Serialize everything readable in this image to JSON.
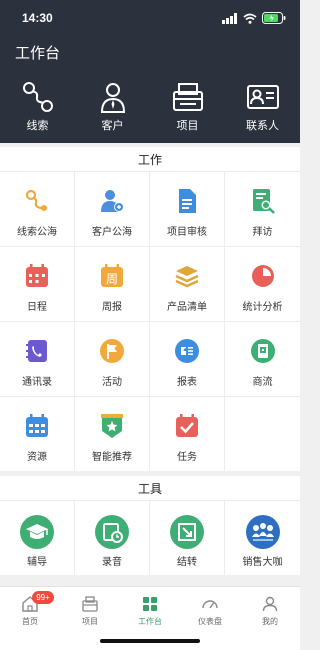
{
  "status": {
    "time": "14:30"
  },
  "header": {
    "title": "工作台",
    "quick": [
      {
        "label": "线索",
        "icon": "clue-icon"
      },
      {
        "label": "客户",
        "icon": "customer-icon"
      },
      {
        "label": "项目",
        "icon": "project-icon"
      },
      {
        "label": "联系人",
        "icon": "contact-icon"
      }
    ]
  },
  "work": {
    "title": "工作",
    "items": [
      {
        "label": "线索公海",
        "icon": "clue-pool-icon"
      },
      {
        "label": "客户公海",
        "icon": "customer-pool-icon"
      },
      {
        "label": "项目审核",
        "icon": "project-review-icon"
      },
      {
        "label": "拜访",
        "icon": "visit-icon"
      },
      {
        "label": "日程",
        "icon": "calendar-icon"
      },
      {
        "label": "周报",
        "icon": "weekly-report-icon"
      },
      {
        "label": "产品清单",
        "icon": "product-list-icon"
      },
      {
        "label": "统计分析",
        "icon": "pie-chart-icon"
      },
      {
        "label": "通讯录",
        "icon": "phonebook-icon"
      },
      {
        "label": "活动",
        "icon": "flag-icon"
      },
      {
        "label": "报表",
        "icon": "report-icon"
      },
      {
        "label": "商流",
        "icon": "commerce-icon"
      },
      {
        "label": "资源",
        "icon": "resource-icon"
      },
      {
        "label": "智能推荐",
        "icon": "recommend-icon"
      },
      {
        "label": "任务",
        "icon": "task-icon"
      }
    ]
  },
  "tools": {
    "title": "工具",
    "items": [
      {
        "label": "辅导",
        "icon": "graduation-cap-icon"
      },
      {
        "label": "录音",
        "icon": "recording-icon"
      },
      {
        "label": "结转",
        "icon": "carry-over-icon"
      },
      {
        "label": "销售大咖",
        "icon": "sales-expert-icon"
      }
    ]
  },
  "tabbar": {
    "tabs": [
      {
        "label": "首页",
        "badge": "99+"
      },
      {
        "label": "项目"
      },
      {
        "label": "工作台"
      },
      {
        "label": "仪表盘"
      },
      {
        "label": "我的"
      }
    ]
  },
  "colors": {
    "header_bg": "#2c323d",
    "accent": "#3aa06b",
    "badge": "#f04a3e"
  }
}
